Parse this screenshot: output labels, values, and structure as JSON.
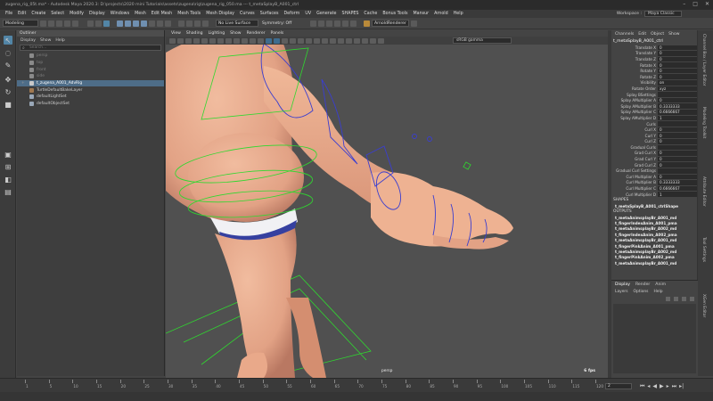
{
  "window": {
    "title": "zugena_rig_05t.ma* - Autodesk Maya 2020.3: D:\\projects\\2020 mini Tutorials\\assets\\zugena\\rig\\zugena_rig_050.ma  ---  t_metaSplayB_A001_ctrl",
    "minimize": "–",
    "maximize": "□",
    "close": "✕"
  },
  "menubar": {
    "items": [
      "File",
      "Edit",
      "Create",
      "Select",
      "Modify",
      "Display",
      "Windows",
      "Mesh",
      "Edit Mesh",
      "Mesh Tools",
      "Mesh Display",
      "Curves",
      "Surfaces",
      "Deform",
      "UV",
      "Generate",
      "SHAPES",
      "Cache",
      "Bonus Tools",
      "Mansur",
      "Arnold",
      "Help"
    ]
  },
  "workspace": {
    "label": "Workspace :",
    "value": "Maya Classic"
  },
  "statusline": {
    "mode": "Modeling",
    "live_surface": "No Live Surface",
    "symmetry": "Symmetry: Off",
    "renderer": "ArnoldRenderer"
  },
  "outliner": {
    "title": "Outliner",
    "menu": [
      "Display",
      "Show",
      "Help"
    ],
    "search_placeholder": "Search...",
    "items": [
      {
        "label": "persp",
        "dim": true,
        "selected": false,
        "color": "#8a8a8a"
      },
      {
        "label": "top",
        "dim": true,
        "selected": false,
        "color": "#8a8a8a"
      },
      {
        "label": "front",
        "dim": true,
        "selected": false,
        "color": "#8a8a8a"
      },
      {
        "label": "side",
        "dim": true,
        "selected": false,
        "color": "#8a8a8a"
      },
      {
        "label": "t_zugena_A001_AdvRig",
        "dim": false,
        "selected": true,
        "color": "#c8c8c8"
      },
      {
        "label": "TurtleDefaultBakeLayer",
        "dim": false,
        "selected": false,
        "color": "#a07850"
      },
      {
        "label": "defaultLightSet",
        "dim": false,
        "selected": false,
        "color": "#9aa8b8"
      },
      {
        "label": "defaultObjectSet",
        "dim": false,
        "selected": false,
        "color": "#9aa8b8"
      }
    ]
  },
  "viewport": {
    "menu": [
      "View",
      "Shading",
      "Lighting",
      "Show",
      "Renderer",
      "Panels"
    ],
    "colorspace": "sRGB gamma",
    "camera_label": "persp",
    "fps": "6 fps"
  },
  "channelbox": {
    "menu": [
      "Channels",
      "Edit",
      "Object",
      "Show"
    ],
    "node": "t_metaSplayB_A001_ctrl",
    "attributes": [
      {
        "name": "Translate X",
        "value": "0"
      },
      {
        "name": "Translate Y",
        "value": "0"
      },
      {
        "name": "Translate Z",
        "value": "0"
      },
      {
        "name": "Rotate X",
        "value": "0"
      },
      {
        "name": "Rotate Y",
        "value": "0"
      },
      {
        "name": "Rotate Z",
        "value": "0"
      },
      {
        "name": "Visibility",
        "value": "on"
      },
      {
        "name": "Rotate Order",
        "value": "xyz"
      },
      {
        "name": "Splay BSettings",
        "value": ""
      },
      {
        "name": "Splay AMultiplier A",
        "value": "0"
      },
      {
        "name": "Splay AMultiplier B",
        "value": "0.3333333"
      },
      {
        "name": "Splay AMultiplier C",
        "value": "0.6666667"
      },
      {
        "name": "Splay AMultiplier D",
        "value": "1"
      },
      {
        "name": "Curls",
        "value": ""
      },
      {
        "name": "Curl X",
        "value": "0"
      },
      {
        "name": "Curl Y",
        "value": "0"
      },
      {
        "name": "Curl Z",
        "value": "0"
      },
      {
        "name": "Gradual Curls",
        "value": ""
      },
      {
        "name": "Grad Curl X",
        "value": "0"
      },
      {
        "name": "Grad Curl Y",
        "value": "0"
      },
      {
        "name": "Grad Curl Z",
        "value": "0"
      },
      {
        "name": "Gradual Curl Settings",
        "value": ""
      },
      {
        "name": "Curl Multiplier A",
        "value": "0"
      },
      {
        "name": "Curl Multiplier B",
        "value": "0.3333333"
      },
      {
        "name": "Curl Multiplier C",
        "value": "0.6666667"
      },
      {
        "name": "Curl Multiplier D",
        "value": "1"
      }
    ],
    "shapes_header": "SHAPES",
    "shapes": [
      "t_metaSplayB_A001_ctrlShape"
    ],
    "outputs_header": "OUTPUTS",
    "outputs": [
      "t_metaAnimsplayBr_A001_md",
      "t_fingerIndexAnim_A001_pma",
      "t_metaAnimsplayBr_A002_md",
      "t_fingerIndexAnim_A002_pma",
      "t_metaAnimsplayBr_A001_md",
      "t_fingerPinkAnim_A001_pma",
      "t_metaAnimsplayBr_A002_md",
      "t_fingerPinkAnim_A002_pma",
      "t_metaAnimsplayBr_A001_md"
    ]
  },
  "side_tabs": [
    "Channel Box / Layer Editor",
    "Modeling Toolkit",
    "Attribute Editor",
    "Tool Settings",
    "XGen Editor"
  ],
  "layers": {
    "tabs": [
      "Display",
      "Render",
      "Anim"
    ],
    "menu": [
      "Layers",
      "Options",
      "Help"
    ]
  },
  "timeslider": {
    "labels": [
      "1",
      "5",
      "10",
      "15",
      "20",
      "25",
      "30",
      "35",
      "40",
      "45",
      "50",
      "55",
      "60",
      "65",
      "70",
      "75",
      "80",
      "85",
      "90",
      "95",
      "100",
      "105",
      "110",
      "115",
      "120"
    ],
    "current_frame": "2"
  },
  "colors": {
    "skin": "#e7a98a",
    "control_blue": "#3a3ed0",
    "control_green": "#2fd82f",
    "selection": "#4e6d88"
  }
}
